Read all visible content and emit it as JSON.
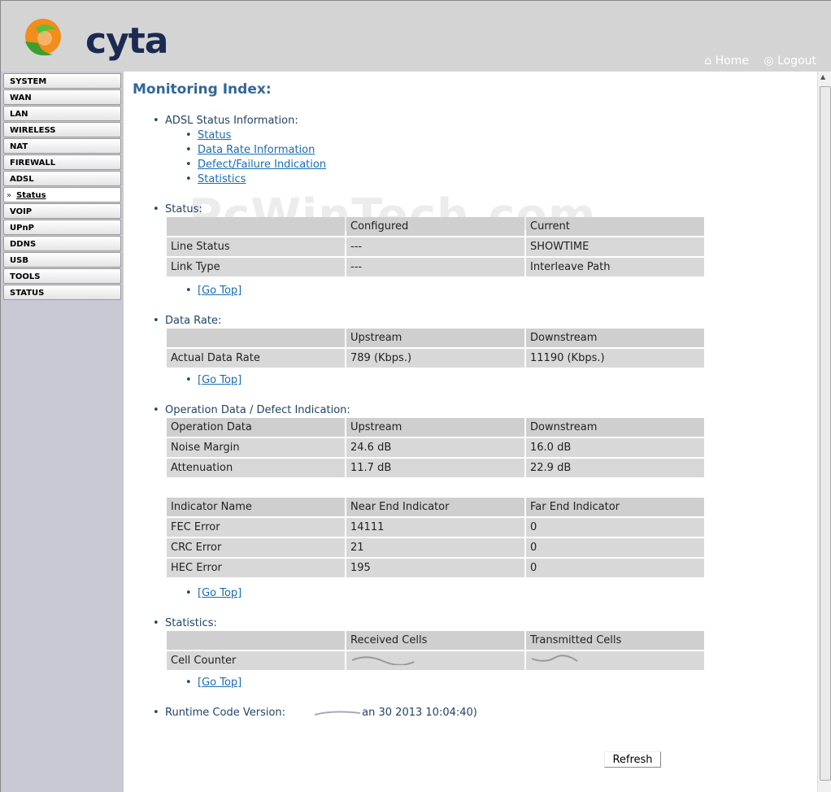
{
  "brand": {
    "name": "cyta"
  },
  "header": {
    "home": "Home",
    "logout": "Logout"
  },
  "sidebar": {
    "items": [
      "SYSTEM",
      "WAN",
      "LAN",
      "WIRELESS",
      "NAT",
      "FIREWALL",
      "ADSL"
    ],
    "sub_item": "Status",
    "items_after": [
      "VOIP",
      "UPnP",
      "DDNS",
      "USB",
      "TOOLS",
      "STATUS"
    ]
  },
  "watermark": "PcWinTech.com",
  "main": {
    "title": "Monitoring Index:",
    "adsl_info": {
      "heading": "ADSL Status Information:",
      "links": [
        "Status",
        "Data Rate Information",
        "Defect/Failure Indication",
        "Statistics"
      ]
    },
    "status": {
      "heading": "Status:",
      "columns": [
        "",
        "Configured",
        "Current"
      ],
      "rows": [
        [
          "Line Status",
          "---",
          "SHOWTIME"
        ],
        [
          "Link Type",
          "---",
          "Interleave Path"
        ]
      ]
    },
    "data_rate": {
      "heading": "Data Rate:",
      "columns": [
        "",
        "Upstream",
        "Downstream"
      ],
      "rows": [
        [
          "Actual Data Rate",
          "789 (Kbps.)",
          "11190 (Kbps.)"
        ]
      ]
    },
    "operation": {
      "heading": "Operation Data / Defect Indication:",
      "columns": [
        "Operation Data",
        "Upstream",
        "Downstream"
      ],
      "rows": [
        [
          "Noise Margin",
          "24.6 dB",
          "16.0 dB"
        ],
        [
          "Attenuation",
          "11.7 dB",
          "22.9 dB"
        ]
      ],
      "indicator_columns": [
        "Indicator Name",
        "Near End Indicator",
        "Far End Indicator"
      ],
      "indicator_rows": [
        [
          "FEC Error",
          "14111",
          "0"
        ],
        [
          "CRC Error",
          "21",
          "0"
        ],
        [
          "HEC Error",
          "195",
          "0"
        ]
      ]
    },
    "statistics": {
      "heading": "Statistics:",
      "columns": [
        "",
        "Received Cells",
        "Transmitted Cells"
      ],
      "rows": [
        [
          "Cell Counter",
          "",
          ""
        ]
      ]
    },
    "go_top": "[Go Top]",
    "runtime": {
      "label": "Runtime Code Version:",
      "value": "an 30 2013 10:04:40)"
    },
    "refresh_label": "Refresh"
  }
}
